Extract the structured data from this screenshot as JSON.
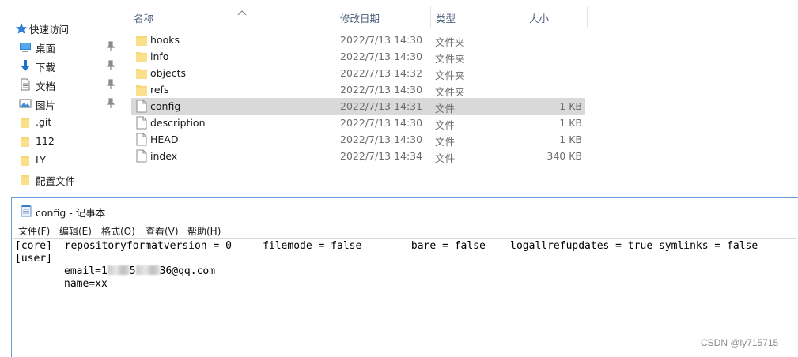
{
  "explorer": {
    "nav": {
      "quick_access": "快速访问",
      "items": [
        {
          "label": "桌面",
          "icon": "desktop-icon",
          "pinned": true
        },
        {
          "label": "下载",
          "icon": "download-icon",
          "pinned": true
        },
        {
          "label": "文档",
          "icon": "documents-icon",
          "pinned": true
        },
        {
          "label": "图片",
          "icon": "pictures-icon",
          "pinned": true
        },
        {
          "label": ".git",
          "icon": "folder-icon",
          "pinned": false
        },
        {
          "label": "112",
          "icon": "folder-icon",
          "pinned": false
        },
        {
          "label": "LY",
          "icon": "folder-icon",
          "pinned": false
        },
        {
          "label": "配置文件",
          "icon": "folder-icon",
          "pinned": false
        }
      ]
    },
    "columns": {
      "name": "名称",
      "modified": "修改日期",
      "type": "类型",
      "size": "大小"
    },
    "files": [
      {
        "name": "hooks",
        "modified": "2022/7/13 14:30",
        "type": "文件夹",
        "size": "",
        "icon": "folder-icon"
      },
      {
        "name": "info",
        "modified": "2022/7/13 14:30",
        "type": "文件夹",
        "size": "",
        "icon": "folder-icon"
      },
      {
        "name": "objects",
        "modified": "2022/7/13 14:32",
        "type": "文件夹",
        "size": "",
        "icon": "folder-icon"
      },
      {
        "name": "refs",
        "modified": "2022/7/13 14:30",
        "type": "文件夹",
        "size": "",
        "icon": "folder-icon"
      },
      {
        "name": "config",
        "modified": "2022/7/13 14:31",
        "type": "文件",
        "size": "1 KB",
        "icon": "file-icon",
        "selected": true
      },
      {
        "name": "description",
        "modified": "2022/7/13 14:30",
        "type": "文件",
        "size": "1 KB",
        "icon": "file-icon"
      },
      {
        "name": "HEAD",
        "modified": "2022/7/13 14:30",
        "type": "文件",
        "size": "1 KB",
        "icon": "file-icon"
      },
      {
        "name": "index",
        "modified": "2022/7/13 14:34",
        "type": "文件",
        "size": "340 KB",
        "icon": "file-icon"
      }
    ]
  },
  "notepad": {
    "title": "config - 记事本",
    "menu": [
      "文件(F)",
      "编辑(E)",
      "格式(O)",
      "查看(V)",
      "帮助(H)"
    ],
    "lines": [
      "[core]  repositoryformatversion = 0     filemode = false        bare = false    logallrefupdates = true symlinks = false",
      "[user]"
    ],
    "email_prefix": "email=1",
    "email_mid": "5",
    "email_suffix": "36@qq.com",
    "name_line": "name=xx"
  },
  "watermark": "CSDN @ly715715",
  "colors": {
    "selection": "#d9d9d9",
    "folder": "#f8d774",
    "column_header": "#4c607a",
    "notepad_border": "#6a9ad6"
  }
}
